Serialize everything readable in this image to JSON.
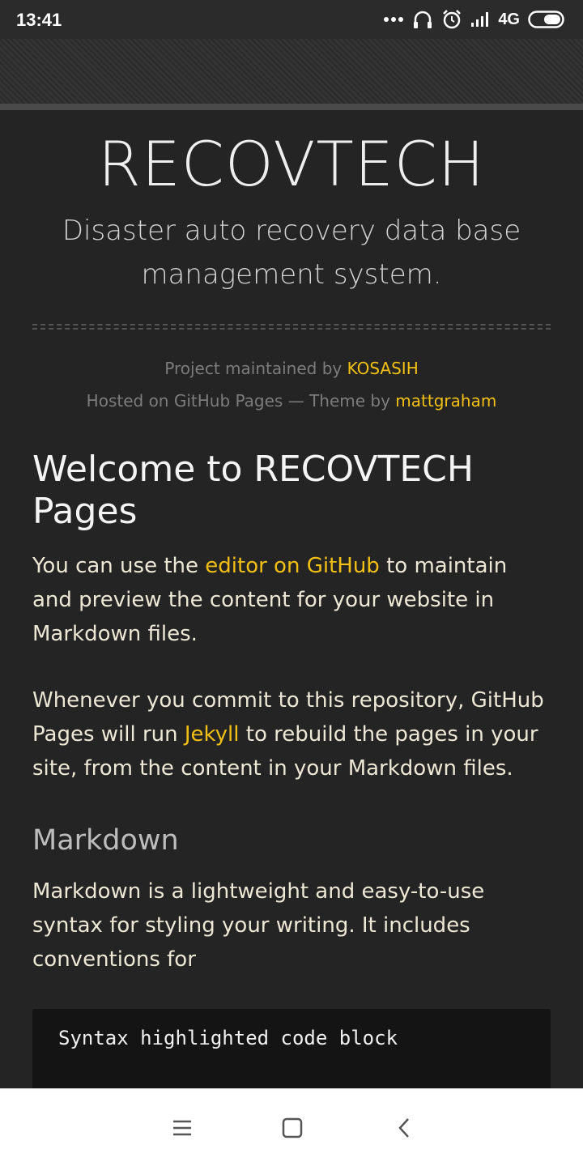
{
  "status_bar": {
    "time": "13:41",
    "network": "4G",
    "icons": [
      "more-dots-icon",
      "headphones-icon",
      "alarm-icon",
      "signal-icon",
      "battery-icon"
    ]
  },
  "site": {
    "title": "RECOVTECH",
    "subtitle": "Disaster auto recovery data base management system.",
    "credits_line1_prefix": "Project maintained by ",
    "credits_line1_link": "KOSASIH",
    "credits_line2_prefix": "Hosted on GitHub Pages — Theme by ",
    "credits_line2_link": "mattgraham"
  },
  "content": {
    "heading": "Welcome to RECOVTECH Pages",
    "para1_before": "You can use the ",
    "para1_link": "editor on GitHub",
    "para1_after": " to maintain and preview the content for your website in Markdown files.",
    "para2_before": "Whenever you commit to this repository, GitHub Pages will run ",
    "para2_link": "Jekyll",
    "para2_after": " to rebuild the pages in your site, from the content in your Markdown files.",
    "subheading": "Markdown",
    "para3": "Markdown is a lightweight and easy-to-use syntax for styling your writing. It includes conventions for",
    "code": "Syntax highlighted code block"
  },
  "colors": {
    "accent_link": "#f2c014",
    "page_bg": "#242424",
    "text": "#ece8d6"
  },
  "nav_bar": {
    "buttons": [
      "menu-icon",
      "home-icon",
      "back-icon"
    ]
  }
}
